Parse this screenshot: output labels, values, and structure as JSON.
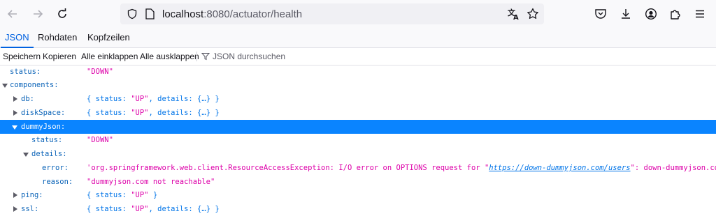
{
  "browser": {
    "url_host": "localhost",
    "url_rest": ":8080/actuator/health",
    "icons": [
      "back-icon",
      "forward-icon",
      "reload-icon",
      "shield-icon",
      "page-icon",
      "translate-icon",
      "bookmark-star-icon",
      "pocket-icon",
      "download-icon",
      "account-icon",
      "extensions-icon",
      "menu-icon"
    ]
  },
  "tabs": [
    "JSON",
    "Rohdaten",
    "Kopfzeilen"
  ],
  "actions": {
    "save": "Speichern",
    "copy": "Kopieren",
    "collapse_all": "Alle einklappen",
    "expand_all": "Alle ausklappen",
    "filter": "JSON durchsuchen"
  },
  "tree": {
    "status_key": "status:",
    "status_val": "\"DOWN\"",
    "components_key": "components:",
    "db_key": "db:",
    "db_p1": "{ status: ",
    "db_up": "\"UP\"",
    "db_p2": ", details: {…} }",
    "disk_key": "diskSpace:",
    "disk_p1": "{ status: ",
    "disk_up": "\"UP\"",
    "disk_p2": ", details: {…} }",
    "dummy_key": "dummyJson:",
    "dstatus_key": "status:",
    "dstatus_val": "\"DOWN\"",
    "details_key": "details:",
    "error_key": "error:",
    "error_pre": "'org.springframework.web.client.ResourceAccessException: I/O error on OPTIONS request for \"",
    "error_link": "https://down-dummyjson.com/users",
    "error_post": "\": down-dummyjson.com'",
    "reason_key": "reason:",
    "reason_val": "\"dummyjson.com not reachable\"",
    "ping_key": "ping:",
    "ping_p1": "{ status: ",
    "ping_up": "\"UP\"",
    "ping_p2": " }",
    "ssl_key": "ssl:",
    "ssl_p1": "{ status: ",
    "ssl_up": "\"UP\"",
    "ssl_p2": ", details: {…} }"
  }
}
